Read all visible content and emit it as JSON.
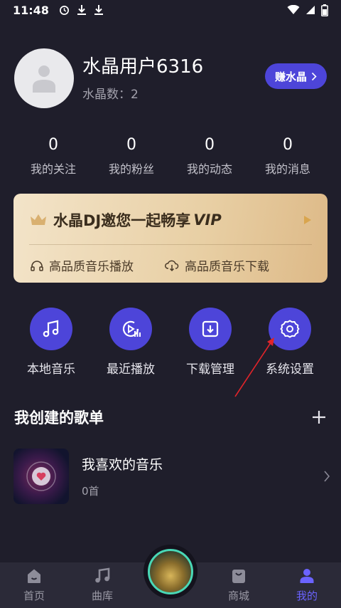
{
  "status_bar": {
    "time": "11:48"
  },
  "profile": {
    "username": "水晶用户6316",
    "crystal_count": "水晶数：2",
    "earn_button": "赚水晶"
  },
  "stats": [
    {
      "value": "0",
      "label": "我的关注"
    },
    {
      "value": "0",
      "label": "我的粉丝"
    },
    {
      "value": "0",
      "label": "我的动态"
    },
    {
      "value": "0",
      "label": "我的消息"
    }
  ],
  "vip": {
    "title": "水晶DJ邀您一起畅享",
    "vip_word": "VIP",
    "features": [
      {
        "label": "高品质音乐播放",
        "icon": "headphones-icon"
      },
      {
        "label": "高品质音乐下载",
        "icon": "cloud-download-icon"
      }
    ]
  },
  "shortcuts": [
    {
      "label": "本地音乐",
      "icon": "music-note-icon"
    },
    {
      "label": "最近播放",
      "icon": "recent-play-icon"
    },
    {
      "label": "下载管理",
      "icon": "download-icon"
    },
    {
      "label": "系统设置",
      "icon": "gear-icon"
    }
  ],
  "playlists_section": {
    "title": "我创建的歌单"
  },
  "playlists": [
    {
      "name": "我喜欢的音乐",
      "count": "0首"
    }
  ],
  "bottom_nav": [
    {
      "label": "首页",
      "icon": "home-icon",
      "active": false
    },
    {
      "label": "曲库",
      "icon": "music-library-icon",
      "active": false
    },
    {
      "label": "商城",
      "icon": "shopping-bag-icon",
      "active": false
    },
    {
      "label": "我的",
      "icon": "user-icon",
      "active": true
    }
  ],
  "colors": {
    "background": "#1f1e2b",
    "accent": "#4d45d9",
    "active_nav": "#6b63ff",
    "vip_gold": "#e8cfa4",
    "annotation_arrow": "#e0242a"
  }
}
